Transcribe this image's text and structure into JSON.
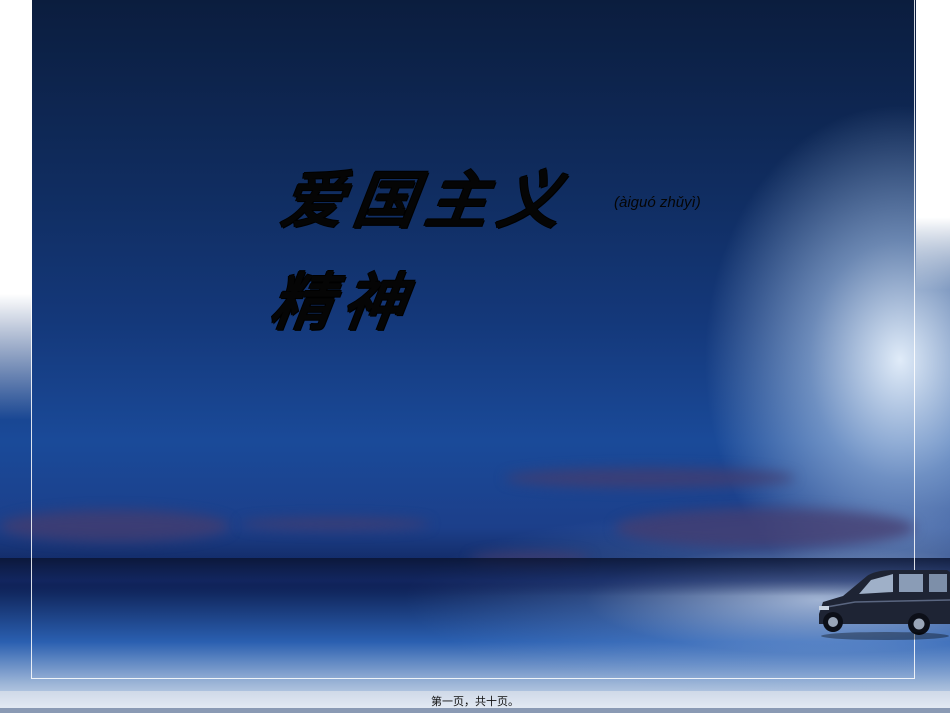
{
  "slide": {
    "title_line_1": "爱国主义",
    "title_line_2": "精神",
    "pinyin": "(àiguó zhǔyì)",
    "page_indicator": "第一页，共十页。"
  },
  "colors": {
    "sky_dark": "#0b1d3e",
    "sky_mid": "#14387a",
    "title_text": "#050505",
    "cloud": "#463c6e"
  },
  "decorations": {
    "car": "car-icon"
  }
}
